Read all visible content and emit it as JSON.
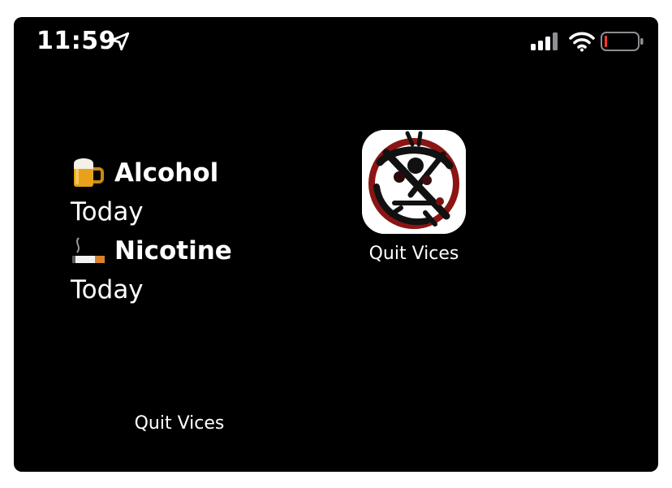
{
  "status_bar": {
    "time": "11:59",
    "icons": [
      "location-arrow-icon",
      "cellular-signal-icon",
      "wifi-icon",
      "battery-low-icon"
    ],
    "battery_color": "#ff3b30"
  },
  "widget": {
    "items": [
      {
        "emoji": "beer-mug-icon",
        "name": "Alcohol",
        "date": "Today"
      },
      {
        "emoji": "cigarette-icon",
        "name": "Nicotine",
        "date": "Today"
      }
    ],
    "label": "Quit Vices"
  },
  "app": {
    "label": "Quit Vices",
    "icon": "quit-vices-app-icon"
  },
  "colors": {
    "background": "#000000",
    "text": "#ffffff"
  }
}
